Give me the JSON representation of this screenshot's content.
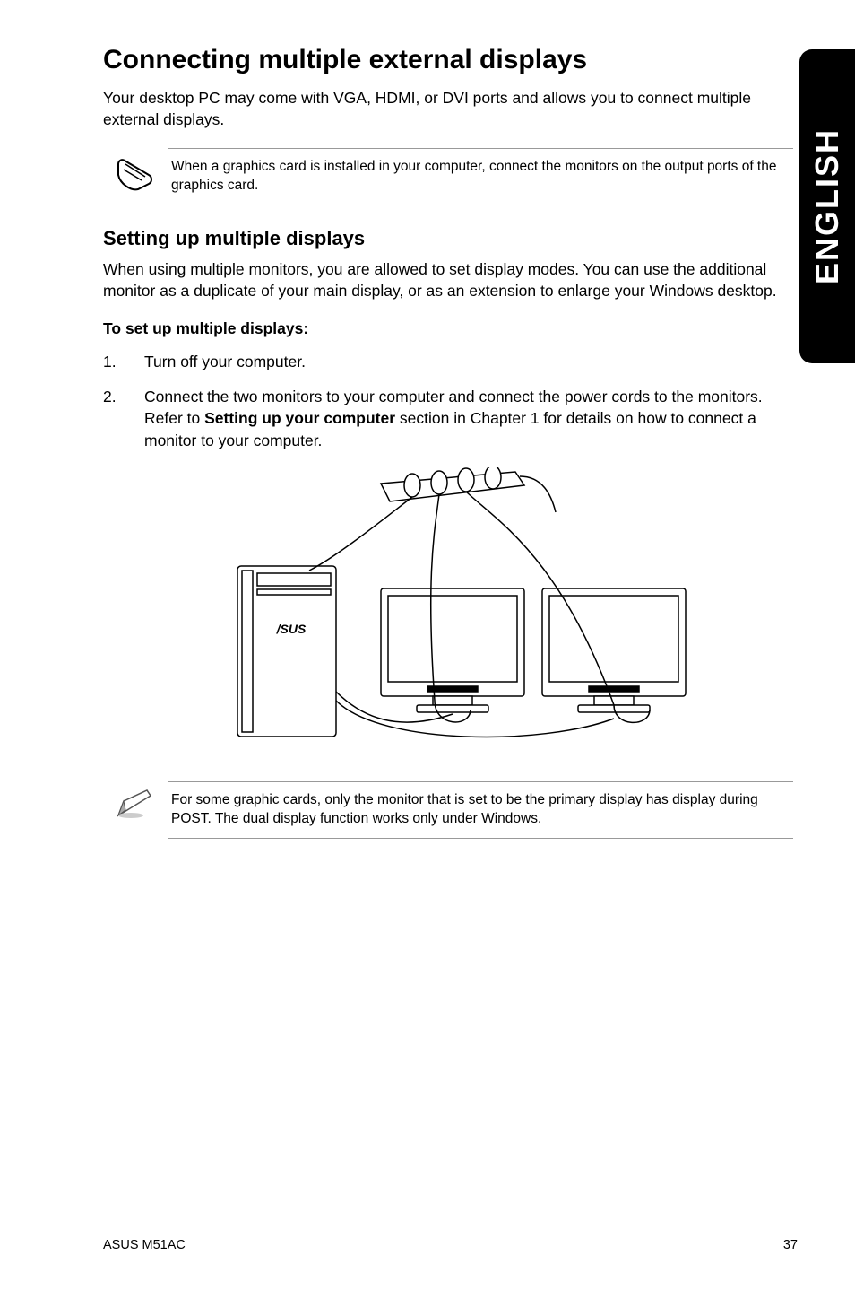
{
  "sideTab": "ENGLISH",
  "heading": "Connecting multiple external displays",
  "intro": "Your desktop PC may come with VGA, HDMI, or DVI ports and allows you to connect multiple external displays.",
  "note1": "When a graphics card is installed in your computer, connect the monitors on the output ports of the graphics card.",
  "subheading": "Setting up multiple displays",
  "subintro": "When using multiple monitors, you are allowed to set display modes. You can use the additional monitor as a duplicate of your main display, or as an extension to enlarge your Windows desktop.",
  "stepsTitle": "To set up multiple displays:",
  "steps": {
    "s1": {
      "num": "1.",
      "text": "Turn off your computer."
    },
    "s2": {
      "num": "2.",
      "pre": "Connect the two monitors to your computer and connect the power cords to the monitors. Refer to ",
      "bold": "Setting up your computer",
      "post": " section in Chapter 1 for details on how to connect a monitor to your computer."
    }
  },
  "note2": "For some graphic cards, only the monitor that is set to be the primary display has display during POST. The dual display function works only under Windows.",
  "footer": {
    "left": "ASUS M51AC",
    "right": "37"
  }
}
